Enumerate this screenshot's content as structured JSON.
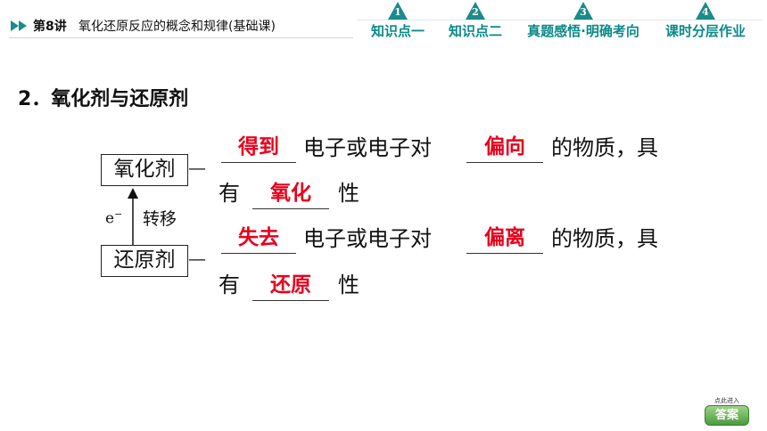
{
  "header": {
    "lesson_number": "第8讲",
    "lesson_title": "氧化还原反应的概念和规律(基础课)",
    "tabs": [
      {
        "num": "1",
        "label": "知识点一"
      },
      {
        "num": "2",
        "label": "知识点二"
      },
      {
        "num": "3",
        "label": "真题感悟·明确考向"
      },
      {
        "num": "4",
        "label": "课时分层作业"
      }
    ]
  },
  "content": {
    "heading": "2．氧化剂与还原剂",
    "oxidizer": {
      "box_label": "氧化剂",
      "answer_gain": "得到",
      "mid_text": "电子或电子对",
      "answer_direction": "偏向",
      "tail_text": "的物质，具",
      "prefix2": "有",
      "answer_property": "氧化",
      "suffix2": "性"
    },
    "reducer": {
      "box_label": "还原剂",
      "answer_lose": "失去",
      "mid_text": "电子或电子对",
      "answer_direction": "偏离",
      "tail_text": "的物质，具",
      "prefix2": "有",
      "answer_property": "还原",
      "suffix2": "性"
    },
    "electron_symbol": "e",
    "electron_charge": "−",
    "transfer_label": "转移",
    "dash": "—"
  },
  "answer_button": {
    "hint": "点此进入",
    "label": "答案"
  },
  "colors": {
    "accent": "#0a8a88",
    "answer_red": "#e8001c",
    "button_green": "#4a9c3c"
  }
}
